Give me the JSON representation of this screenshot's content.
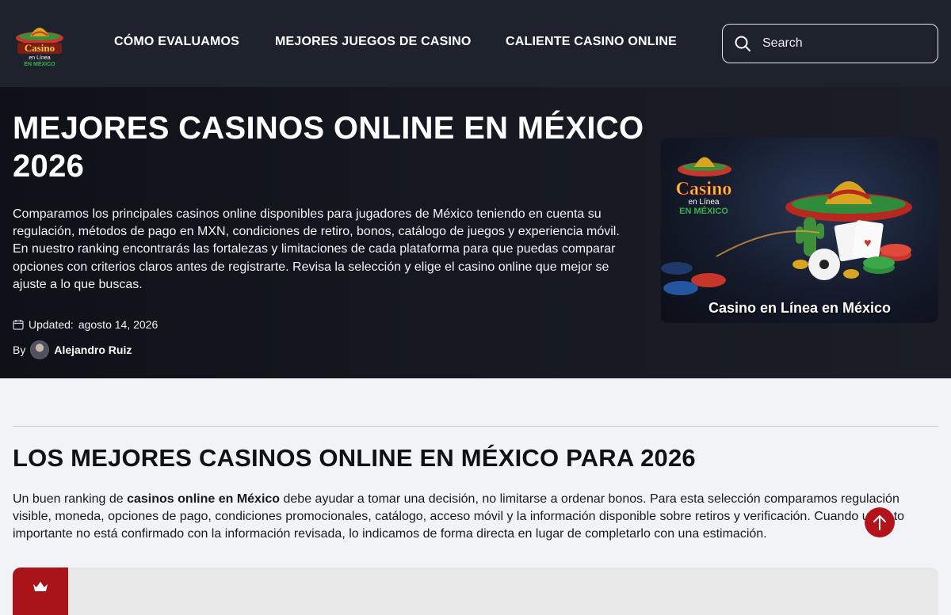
{
  "header": {
    "logo_alt": "Casino en Línea en México",
    "nav": [
      {
        "label": "CÓMO EVALUAMOS"
      },
      {
        "label": "MEJORES JUEGOS DE CASINO"
      },
      {
        "label": "CALIENTE CASINO ONLINE"
      }
    ],
    "search": {
      "placeholder": "Search"
    }
  },
  "hero": {
    "title": "MEJORES CASINOS ONLINE EN MÉXICO 2026",
    "description": "Comparamos los principales casinos online disponibles para jugadores de México teniendo en cuenta su regulación, métodos de pago en MXN, condiciones de retiro, bonos, catálogo de juegos y experiencia móvil. En nuestro ranking encontrarás las fortalezas y limitaciones de cada plataforma para que puedas comparar opciones con criterios claros antes de registrarte. Revisa la selección y elige el casino online que mejor se ajuste a lo que buscas.",
    "updated_label": "Updated:",
    "updated_date": "agosto 14, 2026",
    "by_label": "By",
    "author": "Alejandro Ruiz",
    "image_caption": "Casino en Línea en México"
  },
  "section": {
    "title": "LOS MEJORES CASINOS ONLINE EN MÉXICO PARA 2026",
    "intro_before": "Un buen ranking de ",
    "intro_bold": "casinos online en México",
    "intro_after": " debe ayudar a tomar una decisión, no limitarse a ordenar bonos. Para esta selección comparamos regulación visible, moneda, opciones de pago, condiciones promocionales, catálogo, acceso móvil y la información disponible sobre retiros y verificación. Cuando un dato importante no está confirmado con la información revisada, lo indicamos de forma directa en lugar de completarlo con una estimación."
  },
  "colors": {
    "header_bg": "#1e222c",
    "accent_red": "#b3141b",
    "page_bg": "#f1f3f7"
  },
  "icons": {
    "search": "search-icon",
    "calendar": "calendar-icon",
    "crown": "crown-icon",
    "arrow_up": "arrow-up-icon"
  }
}
